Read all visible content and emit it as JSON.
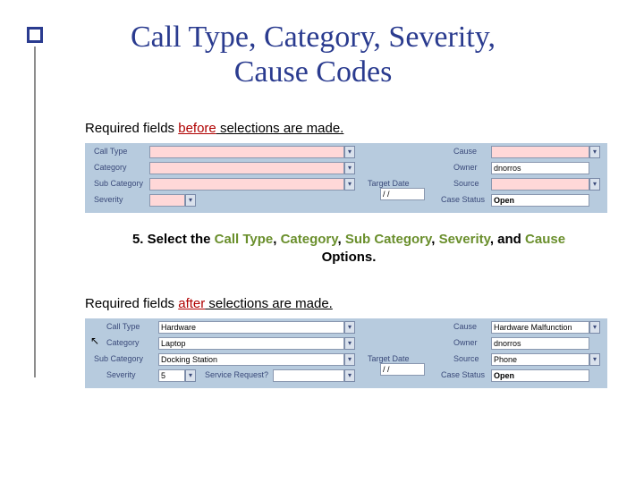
{
  "title": "Call Type, Category, Severity, Cause Codes",
  "before_line": {
    "prefix": "Required fields ",
    "emph": "before",
    "suffix": " selections are made."
  },
  "after_line": {
    "prefix": "Required fields ",
    "emph": "after",
    "suffix": " selections are made."
  },
  "step": {
    "num": "5.",
    "lead": " Select the ",
    "f1": "Call Type",
    "c1": ", ",
    "f2": "Category",
    "c2": ", ",
    "f3": "Sub Category",
    "c3": ", ",
    "f4": "Severity",
    "c4": ", and ",
    "f5": "Cause",
    "tail": " Options."
  },
  "form_before": {
    "call_type_label": "Call Type",
    "call_type_value": "",
    "category_label": "Category",
    "category_value": "",
    "sub_category_label": "Sub Category",
    "sub_category_value": "",
    "severity_label": "Severity",
    "severity_value": "",
    "target_date_label": "Target Date",
    "target_date_value": "/ /",
    "cause_label": "Cause",
    "cause_value": "",
    "owner_label": "Owner",
    "owner_value": "dnorros",
    "source_label": "Source",
    "source_value": "",
    "case_status_label": "Case Status",
    "case_status_value": "Open"
  },
  "form_after": {
    "call_type_label": "Call Type",
    "call_type_value": "Hardware",
    "category_label": "Category",
    "category_value": "Laptop",
    "sub_category_label": "Sub Category",
    "sub_category_value": "Docking Station",
    "severity_label": "Severity",
    "severity_value": "5",
    "service_request_label": "Service Request?",
    "target_date_label": "Target Date",
    "target_date_value": "/ /",
    "cause_label": "Cause",
    "cause_value": "Hardware Malfunction",
    "owner_label": "Owner",
    "owner_value": "dnorros",
    "source_label": "Source",
    "source_value": "Phone",
    "case_status_label": "Case Status",
    "case_status_value": "Open"
  }
}
